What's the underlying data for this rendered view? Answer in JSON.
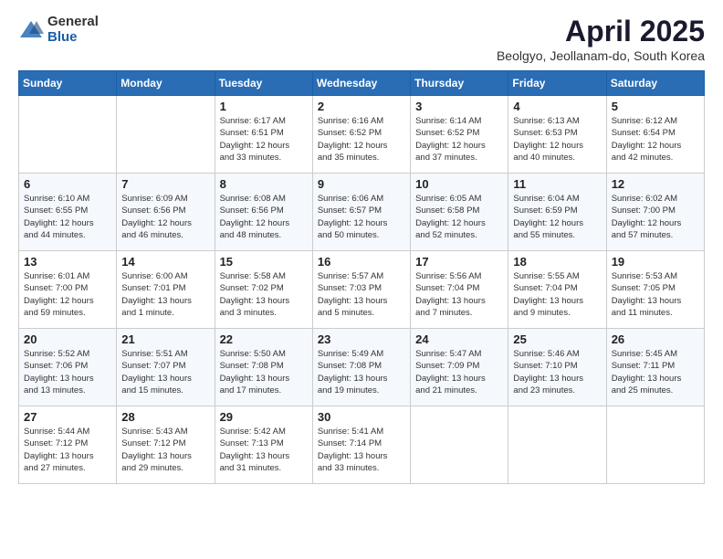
{
  "header": {
    "logo_general": "General",
    "logo_blue": "Blue",
    "title": "April 2025",
    "subtitle": "Beolgyo, Jeollanam-do, South Korea"
  },
  "days_of_week": [
    "Sunday",
    "Monday",
    "Tuesday",
    "Wednesday",
    "Thursday",
    "Friday",
    "Saturday"
  ],
  "weeks": [
    [
      {
        "day": "",
        "info": ""
      },
      {
        "day": "",
        "info": ""
      },
      {
        "day": "1",
        "info": "Sunrise: 6:17 AM\nSunset: 6:51 PM\nDaylight: 12 hours\nand 33 minutes."
      },
      {
        "day": "2",
        "info": "Sunrise: 6:16 AM\nSunset: 6:52 PM\nDaylight: 12 hours\nand 35 minutes."
      },
      {
        "day": "3",
        "info": "Sunrise: 6:14 AM\nSunset: 6:52 PM\nDaylight: 12 hours\nand 37 minutes."
      },
      {
        "day": "4",
        "info": "Sunrise: 6:13 AM\nSunset: 6:53 PM\nDaylight: 12 hours\nand 40 minutes."
      },
      {
        "day": "5",
        "info": "Sunrise: 6:12 AM\nSunset: 6:54 PM\nDaylight: 12 hours\nand 42 minutes."
      }
    ],
    [
      {
        "day": "6",
        "info": "Sunrise: 6:10 AM\nSunset: 6:55 PM\nDaylight: 12 hours\nand 44 minutes."
      },
      {
        "day": "7",
        "info": "Sunrise: 6:09 AM\nSunset: 6:56 PM\nDaylight: 12 hours\nand 46 minutes."
      },
      {
        "day": "8",
        "info": "Sunrise: 6:08 AM\nSunset: 6:56 PM\nDaylight: 12 hours\nand 48 minutes."
      },
      {
        "day": "9",
        "info": "Sunrise: 6:06 AM\nSunset: 6:57 PM\nDaylight: 12 hours\nand 50 minutes."
      },
      {
        "day": "10",
        "info": "Sunrise: 6:05 AM\nSunset: 6:58 PM\nDaylight: 12 hours\nand 52 minutes."
      },
      {
        "day": "11",
        "info": "Sunrise: 6:04 AM\nSunset: 6:59 PM\nDaylight: 12 hours\nand 55 minutes."
      },
      {
        "day": "12",
        "info": "Sunrise: 6:02 AM\nSunset: 7:00 PM\nDaylight: 12 hours\nand 57 minutes."
      }
    ],
    [
      {
        "day": "13",
        "info": "Sunrise: 6:01 AM\nSunset: 7:00 PM\nDaylight: 12 hours\nand 59 minutes."
      },
      {
        "day": "14",
        "info": "Sunrise: 6:00 AM\nSunset: 7:01 PM\nDaylight: 13 hours\nand 1 minute."
      },
      {
        "day": "15",
        "info": "Sunrise: 5:58 AM\nSunset: 7:02 PM\nDaylight: 13 hours\nand 3 minutes."
      },
      {
        "day": "16",
        "info": "Sunrise: 5:57 AM\nSunset: 7:03 PM\nDaylight: 13 hours\nand 5 minutes."
      },
      {
        "day": "17",
        "info": "Sunrise: 5:56 AM\nSunset: 7:04 PM\nDaylight: 13 hours\nand 7 minutes."
      },
      {
        "day": "18",
        "info": "Sunrise: 5:55 AM\nSunset: 7:04 PM\nDaylight: 13 hours\nand 9 minutes."
      },
      {
        "day": "19",
        "info": "Sunrise: 5:53 AM\nSunset: 7:05 PM\nDaylight: 13 hours\nand 11 minutes."
      }
    ],
    [
      {
        "day": "20",
        "info": "Sunrise: 5:52 AM\nSunset: 7:06 PM\nDaylight: 13 hours\nand 13 minutes."
      },
      {
        "day": "21",
        "info": "Sunrise: 5:51 AM\nSunset: 7:07 PM\nDaylight: 13 hours\nand 15 minutes."
      },
      {
        "day": "22",
        "info": "Sunrise: 5:50 AM\nSunset: 7:08 PM\nDaylight: 13 hours\nand 17 minutes."
      },
      {
        "day": "23",
        "info": "Sunrise: 5:49 AM\nSunset: 7:08 PM\nDaylight: 13 hours\nand 19 minutes."
      },
      {
        "day": "24",
        "info": "Sunrise: 5:47 AM\nSunset: 7:09 PM\nDaylight: 13 hours\nand 21 minutes."
      },
      {
        "day": "25",
        "info": "Sunrise: 5:46 AM\nSunset: 7:10 PM\nDaylight: 13 hours\nand 23 minutes."
      },
      {
        "day": "26",
        "info": "Sunrise: 5:45 AM\nSunset: 7:11 PM\nDaylight: 13 hours\nand 25 minutes."
      }
    ],
    [
      {
        "day": "27",
        "info": "Sunrise: 5:44 AM\nSunset: 7:12 PM\nDaylight: 13 hours\nand 27 minutes."
      },
      {
        "day": "28",
        "info": "Sunrise: 5:43 AM\nSunset: 7:12 PM\nDaylight: 13 hours\nand 29 minutes."
      },
      {
        "day": "29",
        "info": "Sunrise: 5:42 AM\nSunset: 7:13 PM\nDaylight: 13 hours\nand 31 minutes."
      },
      {
        "day": "30",
        "info": "Sunrise: 5:41 AM\nSunset: 7:14 PM\nDaylight: 13 hours\nand 33 minutes."
      },
      {
        "day": "",
        "info": ""
      },
      {
        "day": "",
        "info": ""
      },
      {
        "day": "",
        "info": ""
      }
    ]
  ]
}
